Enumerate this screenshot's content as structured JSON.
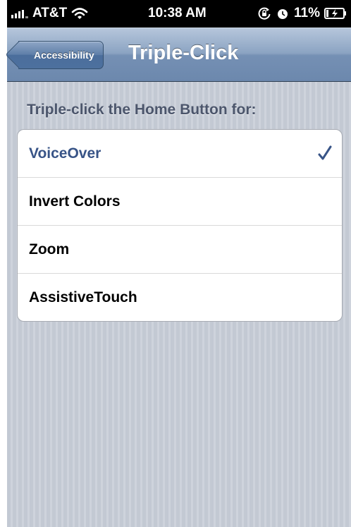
{
  "status_bar": {
    "carrier": "AT&T",
    "time": "10:38 AM",
    "battery": "11%"
  },
  "icons": {
    "signal": "signal-bars-icon",
    "wifi": "wifi-icon",
    "orientation_lock": "orientation-lock-icon",
    "alarm": "alarm-icon",
    "battery": "battery-icon",
    "check": "checkmark-icon"
  },
  "nav": {
    "back_label": "Accessibility",
    "title": "Triple-Click"
  },
  "section": {
    "header": "Triple-click the Home Button for:",
    "options": [
      {
        "label": "VoiceOver",
        "selected": true
      },
      {
        "label": "Invert Colors",
        "selected": false
      },
      {
        "label": "Zoom",
        "selected": false
      },
      {
        "label": "AssistiveTouch",
        "selected": false
      }
    ]
  },
  "colors": {
    "selected_text": "#385487",
    "nav_bar": "#7590b4",
    "background": "#c6ccd6"
  }
}
